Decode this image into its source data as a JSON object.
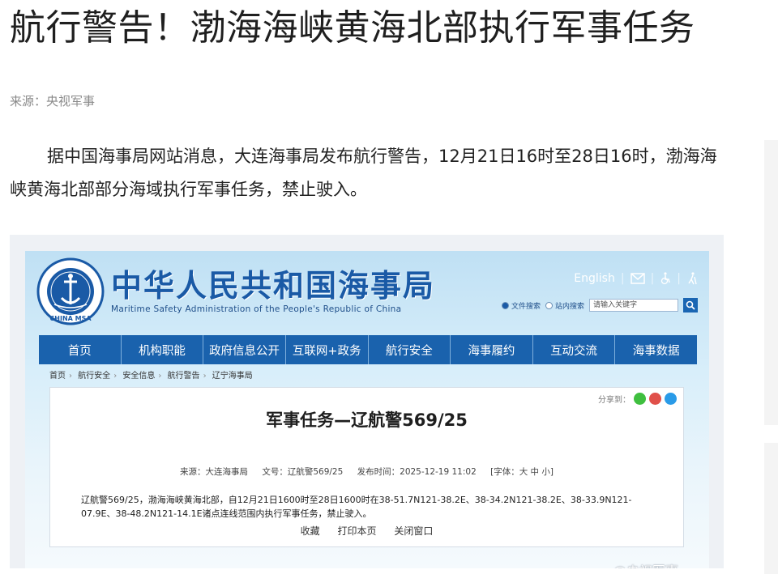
{
  "article": {
    "title": "航行警告！渤海海峡黄海北部执行军事任务",
    "source": "来源：央视军事",
    "paragraph": "据中国海事局网站消息，大连海事局发布航行警告，12月21日16时至28日16时，渤海海峡黄海北部部分海域执行军事任务，禁止驶入。"
  },
  "embedded": {
    "org_cn": "中华人民共和国海事局",
    "org_en": "Maritime Safety Administration of the People's Republic of China",
    "logo_text": "CHINA MSA",
    "top_links": {
      "english": "English",
      "mail_icon": "mail-icon",
      "accessibility_icon": "wheelchair-icon",
      "elder_icon": "elder-icon"
    },
    "search": {
      "option1": "文件搜索",
      "option2": "站内搜索",
      "placeholder": "请输入关键字",
      "button_icon": "search-icon"
    },
    "nav": [
      "首页",
      "机构职能",
      "政府信息公开",
      "互联网+政务",
      "航行安全",
      "海事履约",
      "互动交流",
      "海事数据"
    ],
    "breadcrumb": [
      "首页",
      "航行安全",
      "安全信息",
      "航行警告",
      "辽宁海事局"
    ],
    "share_label": "分享到：",
    "doc": {
      "title": "军事任务—辽航警569/25",
      "source": "来源：大连海事局",
      "doc_no": "文号：辽航警569/25",
      "publish_time": "发布时间：2025-12-19 11:02",
      "font_size": "[字体：大 中 小]",
      "body": "辽航警569/25，渤海海峡黄海北部，自12月21日1600时至28日1600时在38-51.7N121-38.2E、38-34.2N121-38.2E、38-33.9N121-07.9E、38-48.2N121-14.1E诸点连线范围内执行军事任务，禁止驶入。",
      "actions": [
        "收藏",
        "打印本页",
        "关闭窗口"
      ]
    },
    "watermark": "@央视军事"
  },
  "colors": {
    "nav_bg": "#1a62ad",
    "brand_blue": "#1a5aa6",
    "wechat": "#3fbf3f",
    "weibo": "#e0504a",
    "qq": "#2a9be8"
  }
}
